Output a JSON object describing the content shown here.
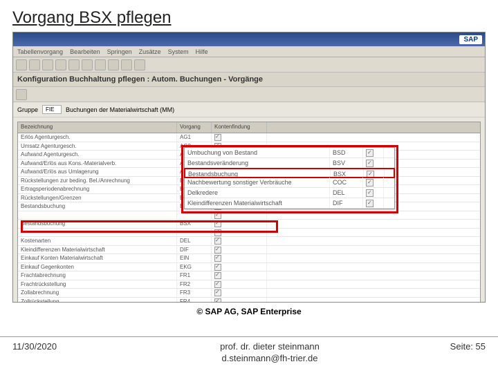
{
  "slide": {
    "title": "Vorgang BSX pflegen",
    "copyright": "© SAP AG, SAP Enterprise",
    "date": "11/30/2020",
    "author": "prof. dr. dieter steinmann",
    "email": "d.steinmann@fh-trier.de",
    "page_label": "Seite: 55"
  },
  "sap": {
    "logo": "SAP",
    "menu": [
      "Tabellenvorgang",
      "Bearbeiten",
      "Springen",
      "Zusätze",
      "System",
      "Hilfe"
    ],
    "heading": "Konfiguration Buchhaltung pflegen : Autom. Buchungen - Vorgänge",
    "subhead_label": "Gruppe",
    "subhead_code": "FIE",
    "subhead_text": "Buchungen der Materialwirtschaft (MM)",
    "col1": "Bezeichnung",
    "col2": "Vorgang",
    "col3": "Kontenfindung",
    "rows": [
      {
        "name": "Erlös Agenturgesch.",
        "code": "AG1"
      },
      {
        "name": "Umsatz Agenturgesch.",
        "code": "AG2"
      },
      {
        "name": "Aufwand Agenturgesch.",
        "code": "AG3"
      },
      {
        "name": "Aufwand/Erlös aus Kons.-Materialverb.",
        "code": "AKO"
      },
      {
        "name": "Aufwand/Erlös aus Umlagerung",
        "code": "AUM"
      },
      {
        "name": "Rückstellungen zur beding. Bel./Anrechnung",
        "code": "B01"
      },
      {
        "name": "Ertragsperiodenabrechnung",
        "code": "B02"
      },
      {
        "name": "Rückstellungen/Grenzen",
        "code": "B03"
      },
      {
        "name": "Bestandsbuchung",
        "code": "BSX"
      },
      {
        "name": "",
        "code": ""
      },
      {
        "name": "Bestandsbuchung",
        "code": "BSX"
      },
      {
        "name": "",
        "code": ""
      },
      {
        "name": "Kostenarten",
        "code": "DEL"
      },
      {
        "name": "Kleindifferenzen Materialwirtschaft",
        "code": "DIF"
      },
      {
        "name": "Einkauf Konten Materialwirtschaft",
        "code": "EIN"
      },
      {
        "name": "Einkauf Gegenkonten",
        "code": "EKG"
      },
      {
        "name": "Frachtabrechnung",
        "code": "FR1"
      },
      {
        "name": "Frachtrückstellung",
        "code": "FR2"
      },
      {
        "name": "Zollabrechnung",
        "code": "FR3"
      },
      {
        "name": "Zollrückstellung",
        "code": "FR4"
      }
    ],
    "overlay": [
      {
        "name": "Umbuchung von Bestand",
        "code": "BSD"
      },
      {
        "name": "Bestandsveränderung",
        "code": "BSV"
      },
      {
        "name": "Bestandsbuchung",
        "code": "BSX",
        "hl": true
      },
      {
        "name": "Nachbewertung sonstiger Verbräuche",
        "code": "COC"
      },
      {
        "name": "Delkredere",
        "code": "DEL"
      },
      {
        "name": "Kleindifferenzen Materialwirtschaft",
        "code": "DIF"
      }
    ]
  }
}
